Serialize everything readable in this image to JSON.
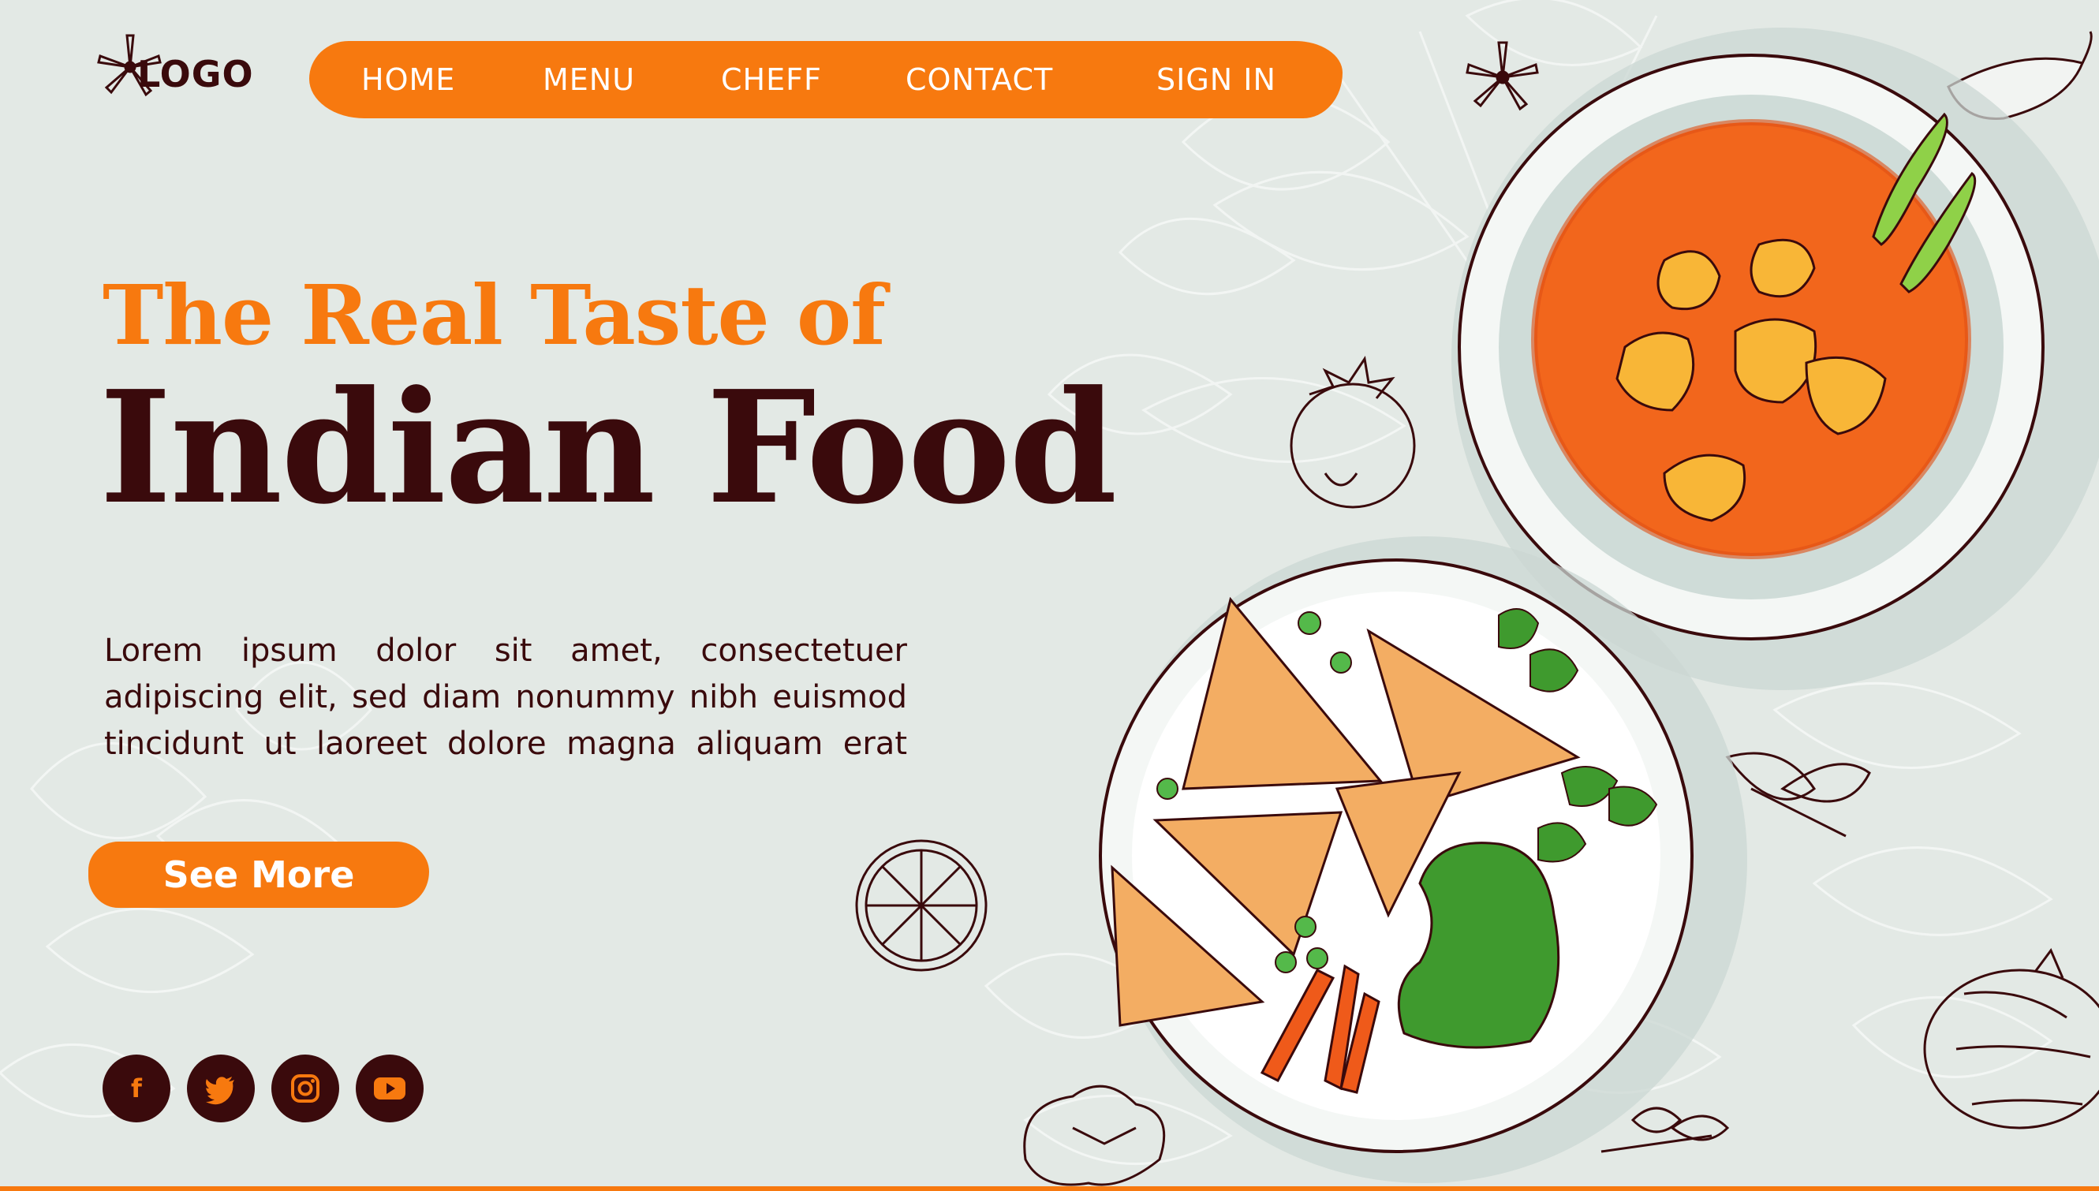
{
  "brand": {
    "logo_text": "LOGO",
    "logo_icon": "star-anise-icon"
  },
  "nav": {
    "items": [
      {
        "label": "HOME"
      },
      {
        "label": "MENU"
      },
      {
        "label": "CHEFF"
      },
      {
        "label": "CONTACT"
      },
      {
        "label": "SIGN IN"
      }
    ]
  },
  "hero": {
    "headline_top": "The Real Taste of",
    "headline_main": "Indian Food",
    "body": "Lorem ipsum dolor sit amet, consectetuer adipiscing elit, sed diam nonummy nibh euismod tincidunt ut laoreet dolore magna aliquam erat",
    "cta_label": "See More"
  },
  "socials": [
    {
      "name": "facebook",
      "glyph": "f"
    },
    {
      "name": "twitter",
      "glyph": ""
    },
    {
      "name": "instagram",
      "glyph": ""
    },
    {
      "name": "youtube",
      "glyph": ""
    }
  ],
  "colors": {
    "background": "#e3e9e5",
    "accent": "#f7790f",
    "dark": "#3a0a0c",
    "curry": "#f2661c",
    "chutney": "#3f9a2e",
    "samosa": "#f3ad63"
  },
  "illustrations": [
    "curry-bowl",
    "samosa-plate",
    "star-anise",
    "tomato",
    "lemon",
    "garlic",
    "onion",
    "chili",
    "basil-leaf"
  ]
}
